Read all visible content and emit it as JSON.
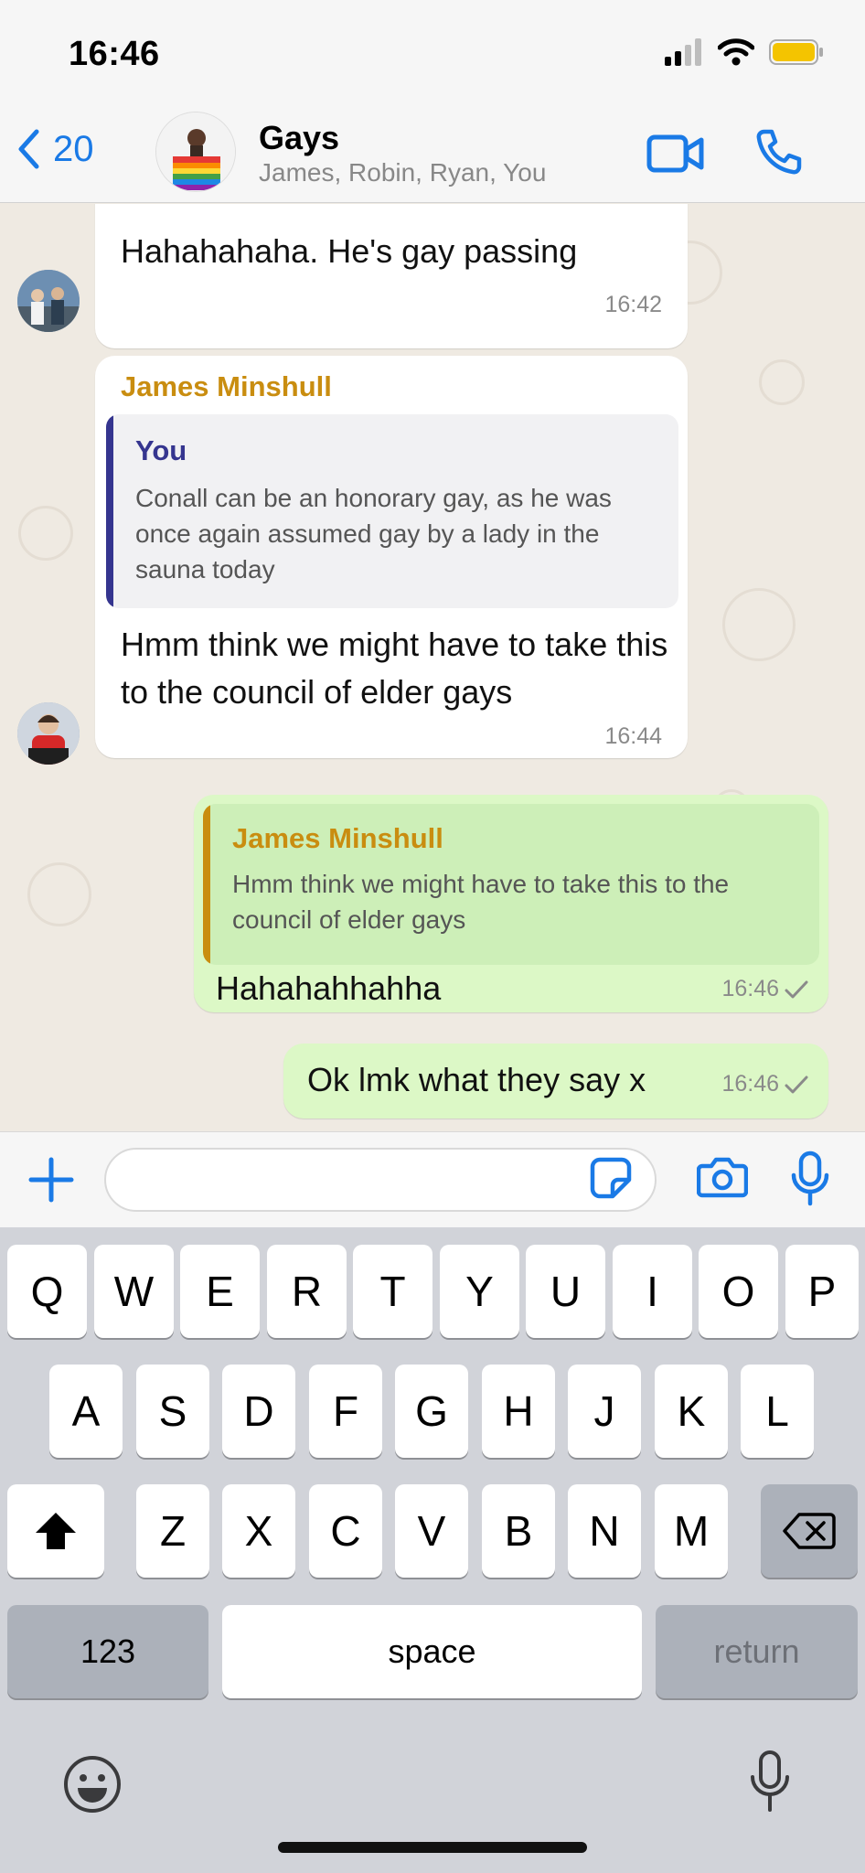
{
  "status_bar": {
    "time": "16:46"
  },
  "header": {
    "back_count": "20",
    "title": "Gays",
    "subtitle": "James, Robin, Ryan, You",
    "icons": {
      "back": "chevron-left-icon",
      "video": "video-camera-icon",
      "call": "phone-icon"
    }
  },
  "messages": [
    {
      "direction": "in",
      "text": "Hahahahaha. He's gay passing",
      "time": "16:42"
    },
    {
      "direction": "in",
      "sender": "James Minshull",
      "quote": {
        "name": "You",
        "text": "Conall can be an honorary gay, as he was once again assumed gay by a lady in the sauna today"
      },
      "text": "Hmm think we might have to take this to the council of elder gays",
      "time": "16:44"
    },
    {
      "direction": "out",
      "quote": {
        "name": "James Minshull",
        "text": "Hmm think we might have to take this to the council of elder gays"
      },
      "text": "Hahahahhahha",
      "time": "16:46"
    },
    {
      "direction": "out",
      "text": "Ok lmk what they say x",
      "time": "16:46"
    }
  ],
  "input_bar": {
    "placeholder": "",
    "icons": {
      "attach": "plus-icon",
      "sticker": "sticker-icon",
      "camera": "camera-icon",
      "mic": "microphone-icon"
    }
  },
  "keyboard": {
    "row1": [
      "Q",
      "W",
      "E",
      "R",
      "T",
      "Y",
      "U",
      "I",
      "O",
      "P"
    ],
    "row2": [
      "A",
      "S",
      "D",
      "F",
      "G",
      "H",
      "J",
      "K",
      "L"
    ],
    "row3": [
      "Z",
      "X",
      "C",
      "V",
      "B",
      "N",
      "M"
    ],
    "numbers_label": "123",
    "space_label": "space",
    "return_label": "return"
  },
  "colors": {
    "accent": "#1a7ae6",
    "sender_name": "#c98d10",
    "quote_self": "#35358f",
    "incoming_bubble": "#ffffff",
    "outgoing_bubble": "#dcf8c6",
    "chat_background": "#efeae2"
  }
}
